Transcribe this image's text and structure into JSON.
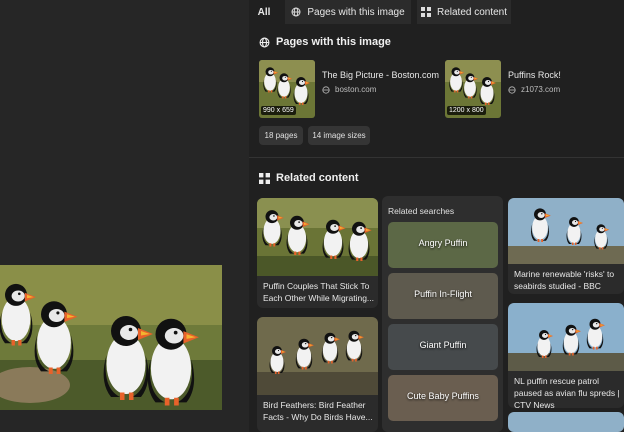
{
  "tabs": {
    "all": "All",
    "pages": "Pages with this image",
    "related": "Related content"
  },
  "pages_section": {
    "title": "Pages with this image",
    "items": [
      {
        "title": "The Big Picture - Boston.com",
        "site": "boston.com",
        "size": "990 x 659"
      },
      {
        "title": "Puffins Rock!",
        "site": "z1073.com",
        "size": "1200 x 800"
      }
    ],
    "chips": [
      "18 pages",
      "14 image sizes"
    ]
  },
  "related_section": {
    "title": "Related content",
    "cards": [
      {
        "caption": "Puffin Couples That Stick To Each Other While Migrating..."
      },
      {
        "caption": "Bird Feathers: Bird Feather Facts - Why Do Birds Have..."
      },
      {
        "caption": "Marine renewable 'risks' to seabirds studied - BBC News"
      },
      {
        "caption": "NL puffin rescue patrol paused as avian flu spreds | CTV News"
      }
    ],
    "related_searches": {
      "title": "Related searches",
      "items": [
        "Angry Puffin",
        "Puffin In-Flight",
        "Giant Puffin",
        "Cute Baby Puffins"
      ]
    }
  },
  "colors": {
    "background": "#202020",
    "panel": "#2b2b2b",
    "text": "#e8e8e8"
  },
  "icons": [
    "pages-globe-icon",
    "related-grid-icon",
    "site-globe-icon"
  ]
}
